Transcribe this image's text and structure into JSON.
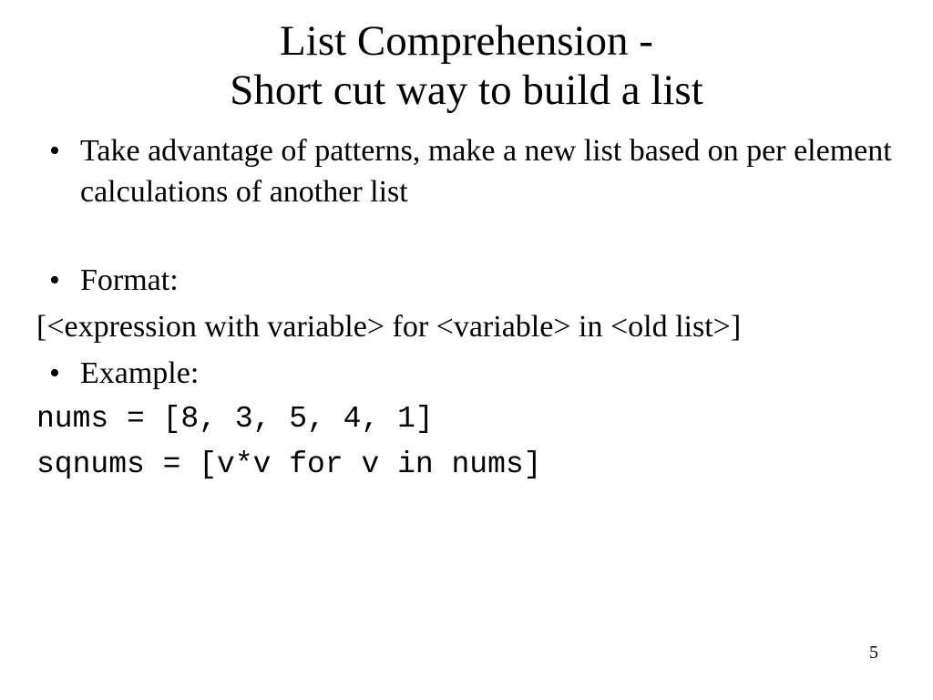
{
  "title_line1": "List Comprehension -",
  "title_line2": "Short cut way to build a list",
  "bullets": {
    "intro": "Take advantage of patterns, make a new list based on per element calculations of another list",
    "format_label": "Format:",
    "format_text": "[<expression with variable> for <variable> in <old list>]",
    "example_label": "Example:",
    "code_line1": "nums = [8, 3, 5, 4, 1]",
    "code_line2": "sqnums =  [v*v  for v in nums]"
  },
  "page_number": "5"
}
